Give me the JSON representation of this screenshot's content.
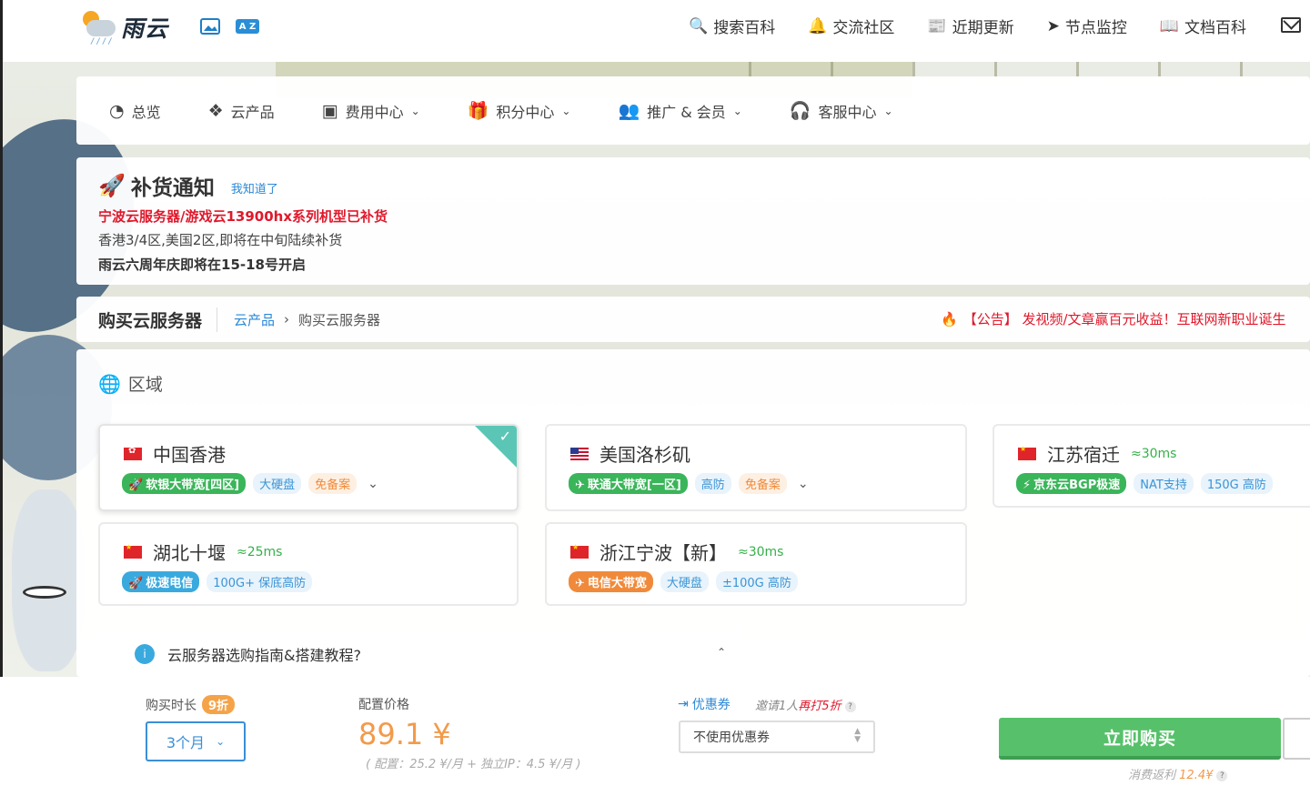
{
  "brand": {
    "name": "雨云",
    "rain": "////"
  },
  "header_icons": {
    "az": "A Z"
  },
  "topnav": [
    {
      "icon": "search-icon",
      "glyph": "🔍",
      "label": "搜索百科"
    },
    {
      "icon": "bell-icon",
      "glyph": "🔔",
      "label": "交流社区"
    },
    {
      "icon": "newspaper-icon",
      "glyph": "📰",
      "label": "近期更新"
    },
    {
      "icon": "send-icon",
      "glyph": "➤",
      "label": "节点监控"
    },
    {
      "icon": "book-icon",
      "glyph": "📖",
      "label": "文档百科"
    }
  ],
  "mainnav": [
    {
      "icon": "dashboard-icon",
      "glyph": "◔",
      "label": "总览",
      "dropdown": false
    },
    {
      "icon": "cubes-icon",
      "glyph": "❖",
      "label": "云产品",
      "dropdown": false
    },
    {
      "icon": "money-icon",
      "glyph": "▣",
      "label": "费用中心",
      "dropdown": true
    },
    {
      "icon": "gift-icon",
      "glyph": "🎁",
      "label": "积分中心",
      "dropdown": true
    },
    {
      "icon": "users-icon",
      "glyph": "👥",
      "label": "推广 & 会员",
      "dropdown": true
    },
    {
      "icon": "headset-icon",
      "glyph": "🎧",
      "label": "客服中心",
      "dropdown": true
    }
  ],
  "notice": {
    "title": "补货通知",
    "ack": "我知道了",
    "line1": "宁波云服务器/游戏云13900hx系列机型已补货",
    "line2": "香港3/4区,美国2区,即将在中旬陆续补货",
    "line3": "雨云六周年庆即将在15-18号开启"
  },
  "breadcrumb": {
    "title": "购买云服务器",
    "parent": "云产品",
    "separator": "›",
    "current": "购买云服务器",
    "announcement": "【公告】 发视频/文章赢百元收益！互联网新职业诞生"
  },
  "region_section": {
    "title": "区域"
  },
  "regions": [
    {
      "name": "中国香港",
      "flag": "hk",
      "latency": "",
      "selected": true,
      "tags": [
        {
          "style": "green",
          "icon": "🚀",
          "text": "软银大带宽[四区]"
        },
        {
          "style": "lblue",
          "text": "大硬盘"
        },
        {
          "style": "lorange",
          "text": "免备案"
        }
      ],
      "more": "⌄"
    },
    {
      "name": "美国洛杉矶",
      "flag": "us",
      "latency": "",
      "selected": false,
      "tags": [
        {
          "style": "green",
          "icon": "✈",
          "text": "联通大带宽[一区]"
        },
        {
          "style": "lblue",
          "text": "高防"
        },
        {
          "style": "lorange",
          "text": "免备案"
        }
      ],
      "more": "⌄"
    },
    {
      "name": "江苏宿迁",
      "flag": "cn",
      "latency": "≈30ms",
      "selected": false,
      "tags": [
        {
          "style": "green",
          "icon": "⚡",
          "text": "京东云BGP极速"
        },
        {
          "style": "lblue",
          "text": "NAT支持"
        },
        {
          "style": "lblue",
          "text": "150G 高防"
        }
      ],
      "more": ""
    },
    {
      "name": "湖北十堰",
      "flag": "cn",
      "latency": "≈25ms",
      "selected": false,
      "tags": [
        {
          "style": "blue",
          "icon": "🚀",
          "text": "极速电信"
        },
        {
          "style": "lblue",
          "text": "100G+ 保底高防"
        }
      ],
      "more": ""
    },
    {
      "name": "浙江宁波【新】",
      "flag": "cn",
      "latency": "≈30ms",
      "selected": false,
      "tags": [
        {
          "style": "orange",
          "icon": "✈",
          "text": "电信大带宽"
        },
        {
          "style": "lblue",
          "text": "大硬盘"
        },
        {
          "style": "lblue",
          "text": "±100G 高防"
        }
      ],
      "more": ""
    }
  ],
  "guide": {
    "text": "云服务器选购指南&搭建教程?",
    "icon": "i",
    "chevron": "⌃"
  },
  "purchase": {
    "duration_label": "购买时长",
    "discount": "9折",
    "duration_value": "3个月",
    "price_label": "配置价格",
    "price": "89.1 ¥",
    "price_detail": "( 配置：25.2 ¥/月 + 独立IP：4.5 ¥/月 )",
    "coupon_label": "优惠券",
    "invite_prefix": "邀请1人",
    "invite_emph": "再打5折",
    "coupon_value": "不使用优惠券",
    "buy_label": "立即购买",
    "rebate_prefix": "消费返利",
    "rebate_amount": "12.4¥"
  },
  "colors": {
    "accent": "#2b88d8",
    "buy": "#56c16a",
    "price": "#f39a4a",
    "alert": "#e0182b"
  }
}
